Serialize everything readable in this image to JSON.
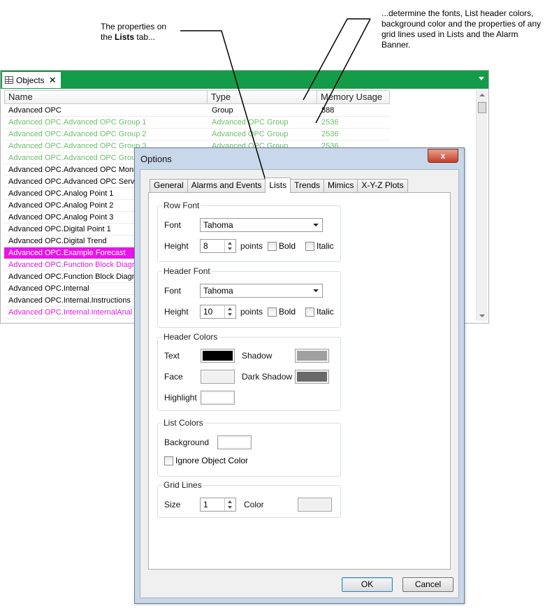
{
  "callouts": {
    "left_line1": "The properties on",
    "left_line2_prefix": "the",
    "left_line2_bold": "Lists",
    "left_line2_suffix": "tab...",
    "right": "...determine the fonts, List header colors, background color and the properties of any grid lines used in Lists and the Alarm Banner."
  },
  "objects_panel": {
    "tab_label": "Objects",
    "columns": [
      "Name",
      "Type",
      "Memory Usage"
    ],
    "rows": [
      {
        "name": "Advanced OPC",
        "type": "Group",
        "memory": "888",
        "style": "normal"
      },
      {
        "name": "Advanced OPC.Advanced OPC Group 1",
        "type": "Advanced OPC Group",
        "memory": "2536",
        "style": "green"
      },
      {
        "name": "Advanced OPC.Advanced OPC Group 2",
        "type": "Advanced OPC Group",
        "memory": "2536",
        "style": "green"
      },
      {
        "name": "Advanced OPC.Advanced OPC Group 3",
        "type": "Advanced OPC Group",
        "memory": "2536",
        "style": "green"
      },
      {
        "name": "Advanced OPC.Advanced OPC Group",
        "type": "",
        "memory": "",
        "style": "green"
      },
      {
        "name": "Advanced OPC.Advanced OPC Monito",
        "type": "",
        "memory": "",
        "style": "normal"
      },
      {
        "name": "Advanced OPC.Advanced OPC Server",
        "type": "",
        "memory": "",
        "style": "normal"
      },
      {
        "name": "Advanced OPC.Analog Point 1",
        "type": "",
        "memory": "",
        "style": "normal"
      },
      {
        "name": "Advanced OPC.Analog Point 2",
        "type": "",
        "memory": "",
        "style": "normal"
      },
      {
        "name": "Advanced OPC.Analog Point 3",
        "type": "",
        "memory": "",
        "style": "normal"
      },
      {
        "name": "Advanced OPC.Digital Point 1",
        "type": "",
        "memory": "",
        "style": "normal"
      },
      {
        "name": "Advanced OPC.Digital Trend",
        "type": "",
        "memory": "",
        "style": "normal"
      },
      {
        "name": "Advanced OPC.Example Forecast",
        "type": "",
        "memory": "",
        "style": "selected"
      },
      {
        "name": "Advanced OPC.Function Block Diagra",
        "type": "",
        "memory": "",
        "style": "magenta"
      },
      {
        "name": "Advanced OPC.Function Block Diagra",
        "type": "",
        "memory": "",
        "style": "normal"
      },
      {
        "name": "Advanced OPC.Internal",
        "type": "",
        "memory": "",
        "style": "normal"
      },
      {
        "name": "Advanced OPC.Internal.Instructions",
        "type": "",
        "memory": "",
        "style": "normal"
      },
      {
        "name": "Advanced OPC.Internal.InternalAnal",
        "type": "",
        "memory": "",
        "style": "magenta"
      }
    ]
  },
  "dialog": {
    "title": "Options",
    "close_label": "x",
    "tabs": [
      "General",
      "Alarms and Events",
      "Lists",
      "Trends",
      "Mimics",
      "X-Y-Z Plots"
    ],
    "active_tab": "Lists",
    "row_font": {
      "title": "Row Font",
      "font_label": "Font",
      "font_value": "Tahoma",
      "height_label": "Height",
      "height_value": "8",
      "points_label": "points",
      "bold_label": "Bold",
      "italic_label": "Italic"
    },
    "header_font": {
      "title": "Header Font",
      "font_label": "Font",
      "font_value": "Tahoma",
      "height_label": "Height",
      "height_value": "10",
      "points_label": "points",
      "bold_label": "Bold",
      "italic_label": "Italic"
    },
    "header_colors": {
      "title": "Header Colors",
      "text_label": "Text",
      "shadow_label": "Shadow",
      "face_label": "Face",
      "dark_shadow_label": "Dark Shadow",
      "highlight_label": "Highlight",
      "text_color": "#000000",
      "shadow_color": "#a0a0a0",
      "face_color": "#f0f0f0",
      "dark_shadow_color": "#696969",
      "highlight_color": "#ffffff"
    },
    "list_colors": {
      "title": "List Colors",
      "background_label": "Background",
      "background_color": "#ffffff",
      "ignore_label": "Ignore Object Color"
    },
    "grid_lines": {
      "title": "Grid Lines",
      "size_label": "Size",
      "size_value": "1",
      "color_label": "Color",
      "color": "#f0f0f0"
    },
    "ok_label": "OK",
    "cancel_label": "Cancel"
  },
  "colors": {
    "objects_tab_bar": "#149b49",
    "row_green": "#6cbf6c",
    "row_magenta": "#e01ae0",
    "row_selected": "#e814e8"
  }
}
